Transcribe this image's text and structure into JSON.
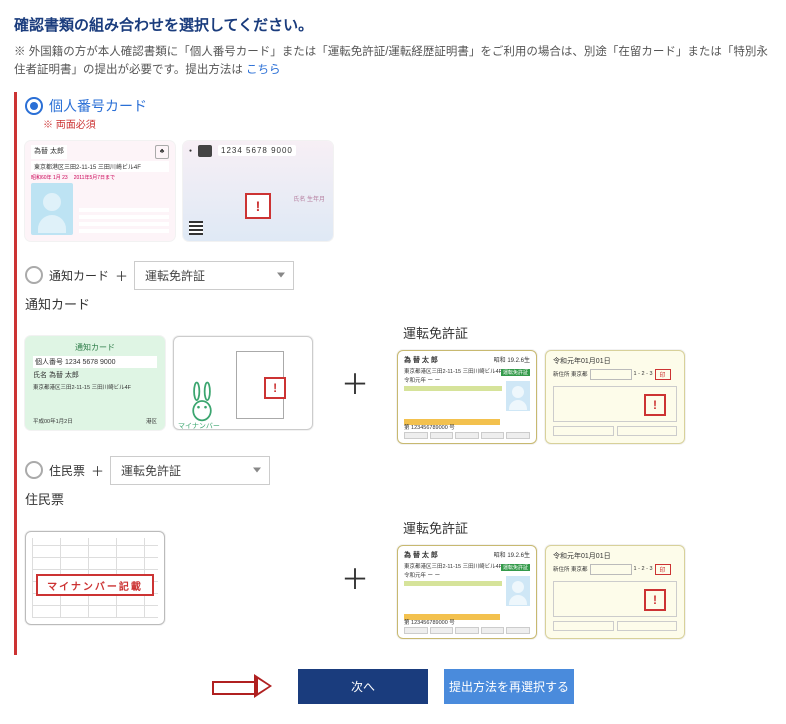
{
  "page": {
    "title": "確認書類の組み合わせを選択してください。",
    "notice_pre": "※ 外国籍の方が本人確認書類に「個人番号カード」または「運転免許証/運転経歴証明書」をご利用の場合は、別途「在留カード」または「特別永住者証明書」の提出が必要です。提出方法は ",
    "notice_link": "こちら"
  },
  "options": {
    "opt1": {
      "label": "個人番号カード",
      "note": "※ 両面必須",
      "selected": true
    },
    "opt2": {
      "label": "通知カード",
      "select": "運転免許証",
      "selected": false
    },
    "opt3": {
      "label": "住民票",
      "select": "運転免許証",
      "selected": false
    }
  },
  "section_labels": {
    "tsuchi": "通知カード",
    "dl": "運転免許証",
    "juminhyo": "住民票"
  },
  "mynumber_card": {
    "name": "為替 太郎",
    "address": "東京都港区三田2-11-15 三田川崎ビル4F",
    "birth": "昭和60年 1月 23",
    "expiry": "2011年5月7日まで",
    "back_number": "1234 5678 9000",
    "back_text": "氏名 生年月"
  },
  "tsuchi_card": {
    "title": "通知カード",
    "number_label": "個人番号",
    "number": "1234 5678 9000",
    "name_label": "氏名",
    "name": "為替 太郎",
    "address": "東京都港区三田2-11-15 三田川崎ビル4F",
    "issue": "平成00年1月2日",
    "issuer": "港区",
    "back_label": "マイナンバー"
  },
  "license": {
    "name": "為 替  太 郎",
    "birth": "昭和 19.2.6生",
    "address": "東京都港区三田2-11-15 三田川崎ビル4F",
    "conditions": "令和元年 ー ー",
    "number": "第 123456789000 号",
    "back_title": "令和元年01月01日",
    "back_addr_label": "新住所 東京都",
    "back_addr": "1 - 2 - 3"
  },
  "juminhyo": {
    "band": "マイナンバー記載"
  },
  "plus": "＋",
  "buttons": {
    "next": "次へ",
    "reselect": "提出方法を再選択する"
  }
}
